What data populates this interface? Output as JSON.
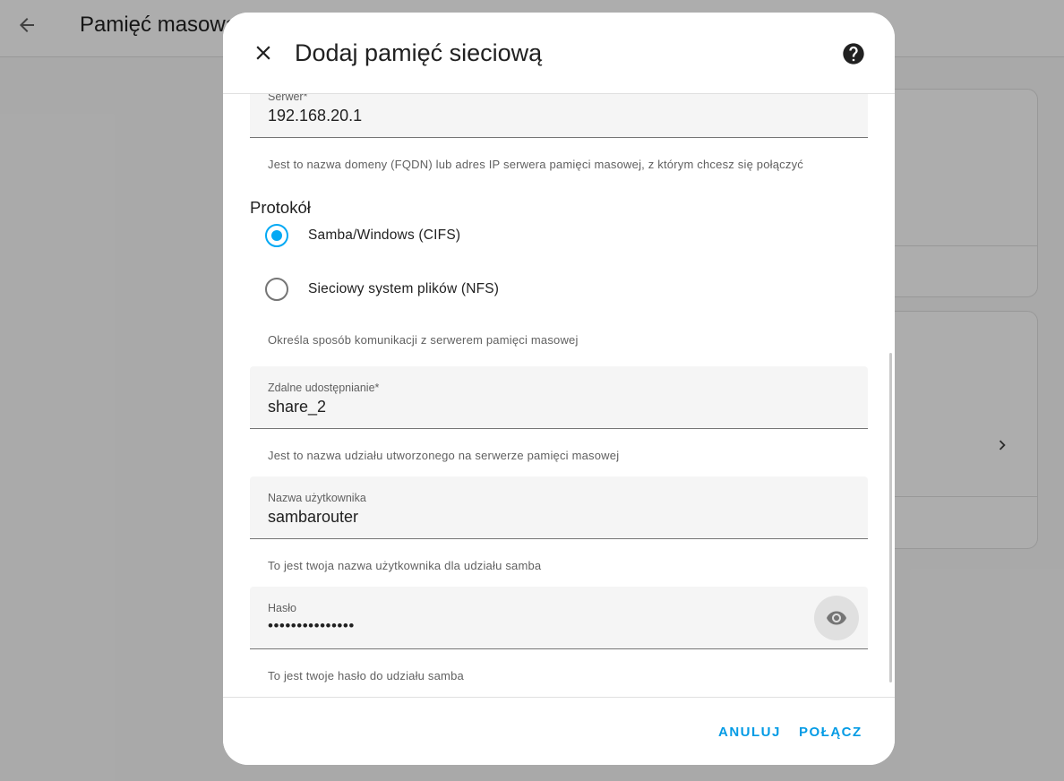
{
  "background": {
    "page_title": "Pamięć masowa"
  },
  "dialog": {
    "title": "Dodaj pamięć sieciową",
    "server": {
      "label": "Serwer*",
      "value": "192.168.20.1",
      "helper": "Jest to nazwa domeny (FQDN) lub adres IP serwera pamięci masowej, z którym chcesz się połączyć"
    },
    "protocol": {
      "title": "Protokół",
      "options": [
        {
          "label": "Samba/Windows (CIFS)",
          "selected": true
        },
        {
          "label": "Sieciowy system plików (NFS)",
          "selected": false
        }
      ],
      "helper": "Określa sposób komunikacji z serwerem pamięci masowej"
    },
    "share": {
      "label": "Zdalne udostępnianie*",
      "value": "share_2",
      "helper": "Jest to nazwa udziału utworzonego na serwerze pamięci masowej"
    },
    "username": {
      "label": "Nazwa użytkownika",
      "value": "sambarouter",
      "helper": "To jest twoja nazwa użytkownika dla udziału samba"
    },
    "password": {
      "label": "Hasło",
      "value": "•••••••••••••••",
      "helper": "To jest twoje hasło do udziału samba"
    },
    "buttons": {
      "cancel": "ANULUJ",
      "connect": "POŁĄCZ"
    }
  },
  "colors": {
    "accent": "#03a9f4",
    "button_text": "#039be5",
    "scrim": "rgba(0,0,0,0.32)"
  },
  "icons": {
    "back": "arrow-left-icon",
    "close": "close-icon",
    "help": "help-circle-icon",
    "eye": "eye-icon",
    "chevron": "chevron-right-icon"
  }
}
